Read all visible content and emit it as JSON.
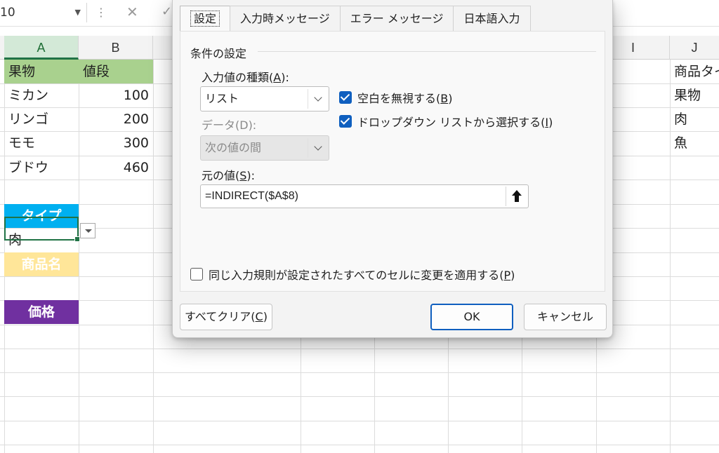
{
  "formula_bar": {
    "namebox": "10"
  },
  "sheet": {
    "columns": [
      {
        "key": "A",
        "label": "A"
      },
      {
        "key": "B",
        "label": "B"
      },
      {
        "key": "I",
        "label": "I"
      },
      {
        "key": "J",
        "label": "J"
      }
    ],
    "cells": {
      "A1": "果物",
      "B1": "値段",
      "A2": "ミカン",
      "B2": "100",
      "A3": "リンゴ",
      "B3": "200",
      "A4": "モモ",
      "B4": "300",
      "A5": "ブドウ",
      "B5": "460",
      "A7": "タイプ",
      "A8": "肉",
      "A9": "商品名",
      "A11": "価格",
      "J1": "商品タイプ",
      "J2": "果物",
      "J3": "肉",
      "J4": "魚"
    },
    "colors": {
      "header_green": "#a9d18e",
      "type_cyan": "#00b0f0",
      "name_yellow": "#ffe699",
      "price_purple": "#7030a0",
      "selection_green": "#217346"
    }
  },
  "dialog": {
    "tabs": [
      "設定",
      "入力時メッセージ",
      "エラー メッセージ",
      "日本語入力"
    ],
    "active_tab": "設定",
    "section_title": "条件の設定",
    "allow": {
      "label_prefix": "入力値の種類(",
      "label_key": "A",
      "label_suffix": "):",
      "value": "リスト"
    },
    "data": {
      "label": "データ(D):",
      "value": "次の値の間"
    },
    "ignore_blank": {
      "label_prefix": "空白を無視する(",
      "label_key": "B",
      "label_suffix": ")",
      "checked": true
    },
    "in_cell_dropdown": {
      "label_prefix": "ドロップダウン リストから選択する(",
      "label_key": "I",
      "label_suffix": ")",
      "checked": true
    },
    "source": {
      "label_prefix": "元の値(",
      "label_key": "S",
      "label_suffix": "):",
      "value": "=INDIRECT($A$8)",
      "collapse_icon": "up-arrow-icon"
    },
    "apply_all": {
      "label_prefix": "同じ入力規則が設定されたすべてのセルに変更を適用する(",
      "label_key": "P",
      "label_suffix": ")",
      "checked": false
    },
    "buttons": {
      "clear_prefix": "すべてクリア(",
      "clear_key": "C",
      "clear_suffix": ")",
      "ok": "OK",
      "cancel": "キャンセル"
    },
    "accent_color": "#0f5fbf"
  }
}
